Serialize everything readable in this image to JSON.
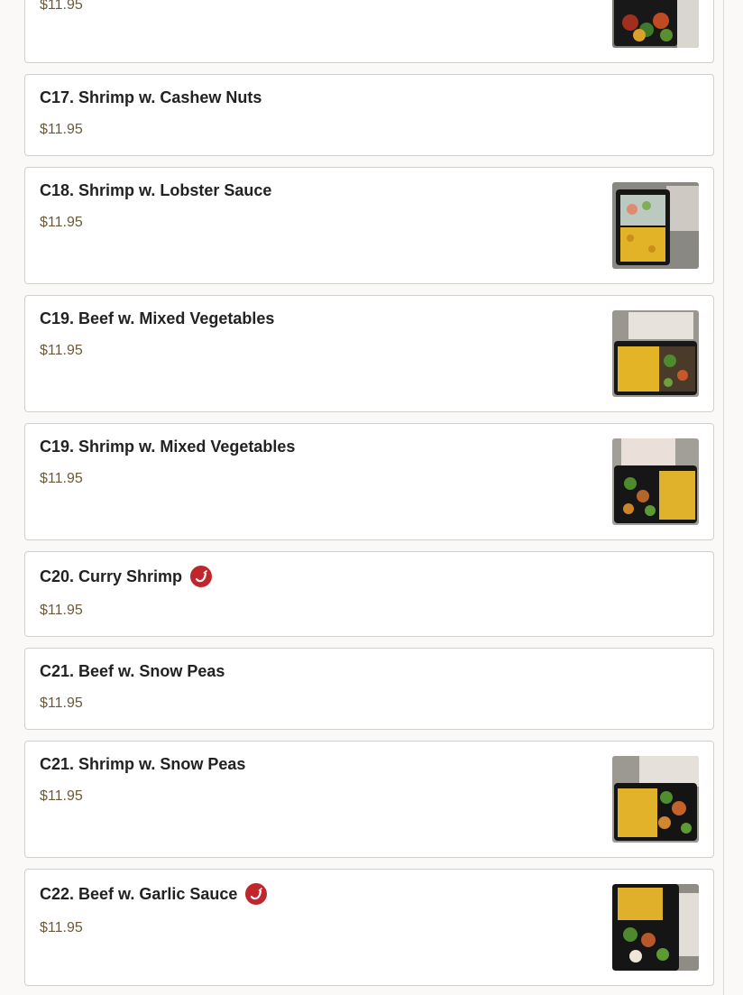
{
  "menu_items": [
    {
      "title": "",
      "price": "$11.95",
      "spicy": false,
      "has_photo": true
    },
    {
      "title": "C17. Shrimp w. Cashew Nuts",
      "price": "$11.95",
      "spicy": false,
      "has_photo": false
    },
    {
      "title": "C18. Shrimp w. Lobster Sauce",
      "price": "$11.95",
      "spicy": false,
      "has_photo": true
    },
    {
      "title": "C19. Beef w. Mixed Vegetables",
      "price": "$11.95",
      "spicy": false,
      "has_photo": true
    },
    {
      "title": "C19. Shrimp w. Mixed Vegetables",
      "price": "$11.95",
      "spicy": false,
      "has_photo": true
    },
    {
      "title": "C20. Curry Shrimp",
      "price": "$11.95",
      "spicy": true,
      "has_photo": false
    },
    {
      "title": "C21. Beef w. Snow Peas",
      "price": "$11.95",
      "spicy": false,
      "has_photo": false
    },
    {
      "title": "C21. Shrimp w. Snow Peas",
      "price": "$11.95",
      "spicy": false,
      "has_photo": true
    },
    {
      "title": "C22. Beef w. Garlic Sauce",
      "price": "$11.95",
      "spicy": true,
      "has_photo": true
    }
  ],
  "icons": {
    "spicy": "chili-pepper-icon"
  },
  "colors": {
    "price": "#6b5a3a",
    "spicy_badge": "#c0272d",
    "card_border": "#d2d0cc"
  }
}
